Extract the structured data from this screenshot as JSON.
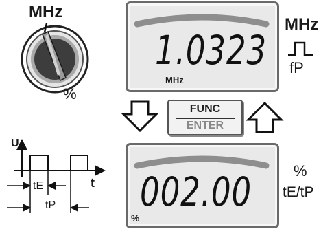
{
  "rotary_switch": {
    "top_label": "MHz",
    "bottom_label": "%"
  },
  "display_top": {
    "reading": "1.0323",
    "unit": "MHz"
  },
  "display_bottom": {
    "reading": "002.00",
    "unit": "%"
  },
  "func_button": {
    "top_label": "FUNC",
    "bottom_label": "ENTER"
  },
  "side_labels": {
    "top_unit": "MHz",
    "top_symbol": "fP",
    "bottom_unit": "%",
    "bottom_symbol": "tE/tP"
  },
  "waveform": {
    "y_axis_label": "U",
    "x_axis_label": "t",
    "pulse_width_label": "tE",
    "period_label": "tP"
  },
  "icons": {
    "rotary_switch": "rotary-selector-icon",
    "arrow_down": "hollow-arrow-down-icon",
    "arrow_up": "hollow-arrow-up-icon",
    "square_pulse": "square-pulse-icon"
  }
}
